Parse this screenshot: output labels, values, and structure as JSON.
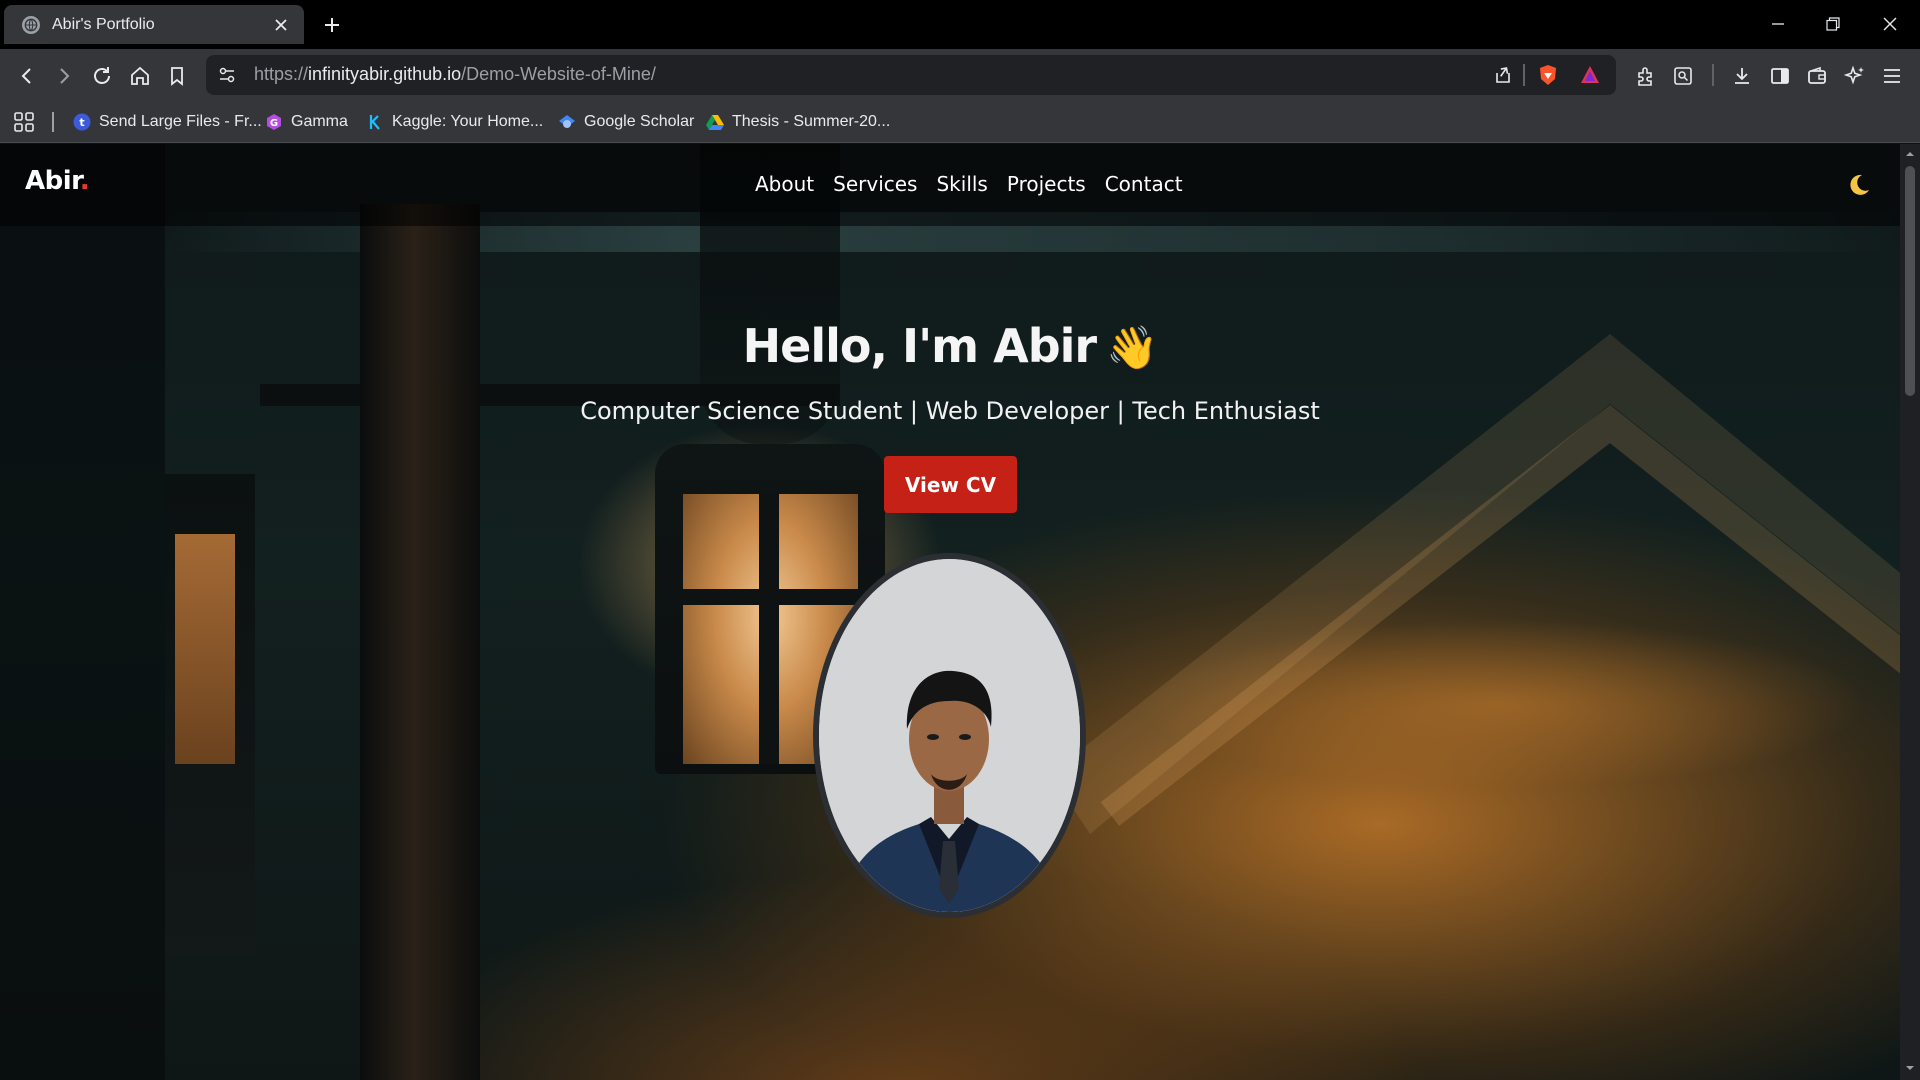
{
  "browser": {
    "tab": {
      "title": "Abir's Portfolio"
    },
    "address": {
      "scheme": "https://",
      "host": "infinityabir.github.io",
      "path": "/Demo-Website-of-Mine/"
    },
    "bookmarks": [
      {
        "label": "Send Large Files - Fr...",
        "icon": "transfer-icon",
        "color": "#3b5bdb"
      },
      {
        "label": "Gamma",
        "icon": "gamma-icon",
        "color": "#b44de0"
      },
      {
        "label": "Kaggle: Your Home...",
        "icon": "kaggle-icon",
        "color": "#20beff"
      },
      {
        "label": "Google Scholar",
        "icon": "scholar-icon",
        "color": "#4285f4"
      },
      {
        "label": "Thesis - Summer-20...",
        "icon": "google-drive-icon",
        "color": "#fbbc04"
      }
    ]
  },
  "site": {
    "logo": {
      "text": "Abir",
      "dot": "."
    },
    "nav": [
      "About",
      "Services",
      "Skills",
      "Projects",
      "Contact"
    ],
    "theme_icon": "moon-icon",
    "hero": {
      "title": "Hello, I'm Abir",
      "wave": "👋",
      "subtitle": "Computer Science Student | Web Developer | Tech Enthusiast",
      "cta": "View CV"
    },
    "colors": {
      "accent": "#c62117",
      "logo_dot": "#e53935"
    }
  }
}
